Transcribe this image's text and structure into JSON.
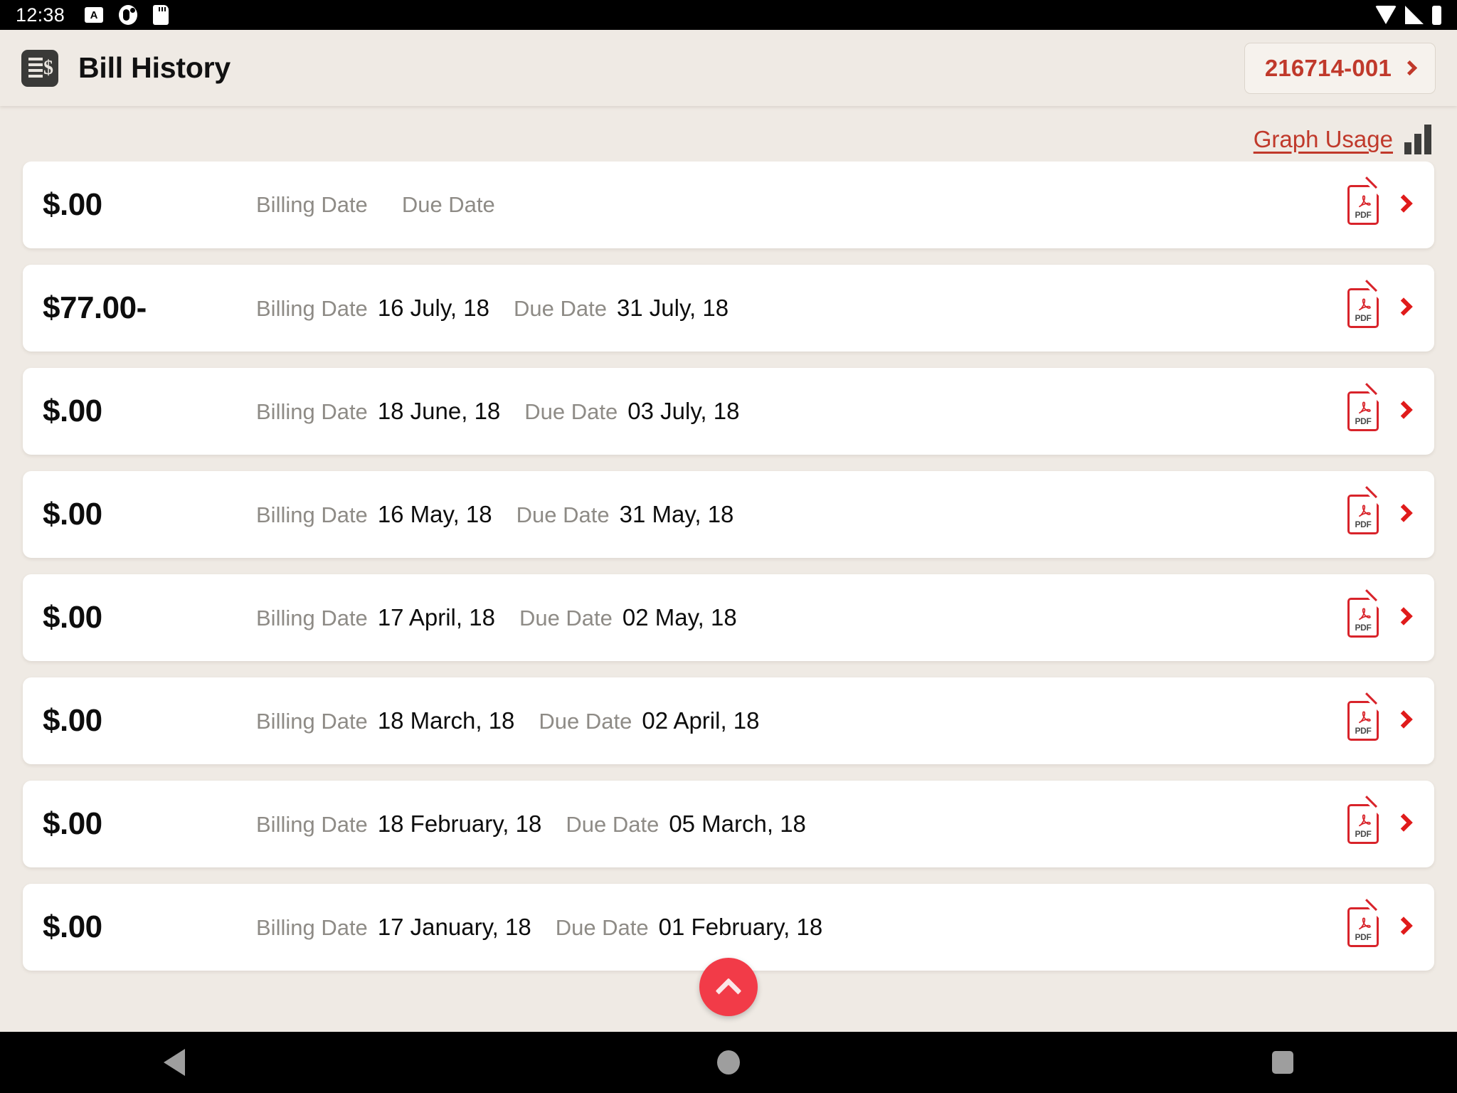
{
  "status_bar": {
    "time": "12:38",
    "left_icons": [
      "caption-icon",
      "do-not-disturb-icon",
      "sd-card-icon"
    ],
    "right_icons": [
      "wifi-icon",
      "cell-signal-icon",
      "battery-icon"
    ]
  },
  "header": {
    "app_icon": "bill-document-icon",
    "title": "Bill History",
    "account_button": {
      "label": "216714-001",
      "chevron": "chevron-right-icon"
    }
  },
  "toolbar": {
    "graph_usage_label": "Graph Usage",
    "graph_icon": "bar-chart-icon"
  },
  "labels": {
    "billing_date": "Billing Date",
    "due_date": "Due Date",
    "pdf": "PDF"
  },
  "bills": [
    {
      "amount": "$.00",
      "billing_date": "",
      "due_date": ""
    },
    {
      "amount": "$77.00-",
      "billing_date": "16 July, 18",
      "due_date": "31 July, 18"
    },
    {
      "amount": "$.00",
      "billing_date": "18 June, 18",
      "due_date": "03 July, 18"
    },
    {
      "amount": "$.00",
      "billing_date": "16 May, 18",
      "due_date": "31 May, 18"
    },
    {
      "amount": "$.00",
      "billing_date": "17 April, 18",
      "due_date": "02 May, 18"
    },
    {
      "amount": "$.00",
      "billing_date": "18 March, 18",
      "due_date": "02 April, 18"
    },
    {
      "amount": "$.00",
      "billing_date": "18 February, 18",
      "due_date": "05 March, 18"
    },
    {
      "amount": "$.00",
      "billing_date": "17 January, 18",
      "due_date": "01 February, 18"
    }
  ],
  "fab": {
    "icon": "chevron-up-icon"
  },
  "nav_bar": {
    "back": "back-triangle-icon",
    "home": "home-circle-icon",
    "recents": "recents-square-icon"
  },
  "colors": {
    "background": "#EFEAE4",
    "card": "#FFFFFF",
    "accent_red": "#C0392B",
    "bright_red": "#E01B1B",
    "fab_red": "#F23B48",
    "muted_text": "#8E8B86"
  }
}
